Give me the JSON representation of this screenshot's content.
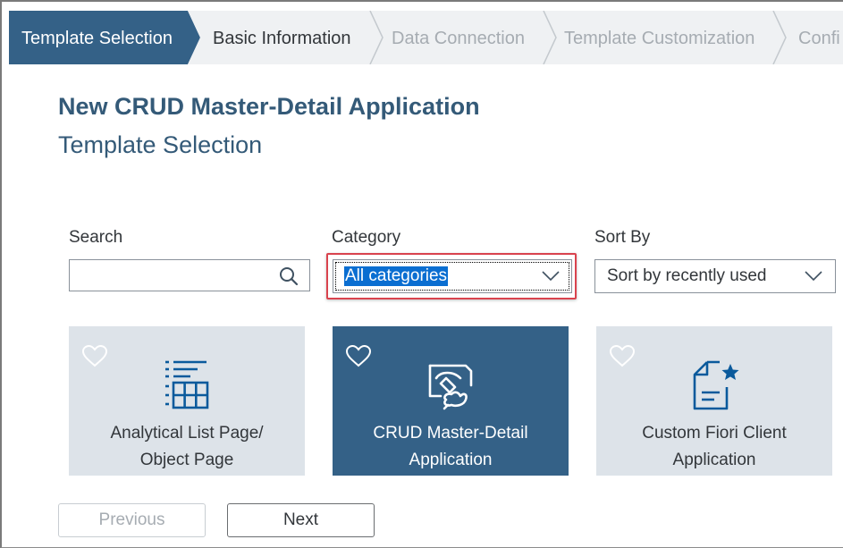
{
  "wizard": {
    "steps": [
      {
        "label": "Template Selection",
        "state": "active"
      },
      {
        "label": "Basic Information",
        "state": "normal"
      },
      {
        "label": "Data Connection",
        "state": "disabled"
      },
      {
        "label": "Template Customization",
        "state": "disabled"
      },
      {
        "label": "Confi",
        "state": "disabled"
      }
    ]
  },
  "page": {
    "title": "New CRUD Master-Detail Application",
    "subtitle": "Template Selection"
  },
  "filters": {
    "search_label": "Search",
    "search_value": "",
    "category_label": "Category",
    "category_value": "All categories",
    "sort_label": "Sort By",
    "sort_value": "Sort by recently used"
  },
  "tiles": [
    {
      "label": "Analytical List Page/\nObject Page",
      "icon": "analytical-list-icon",
      "selected": false
    },
    {
      "label": "CRUD Master-Detail\nApplication",
      "icon": "crud-master-detail-icon",
      "selected": true
    },
    {
      "label": "Custom Fiori Client\nApplication",
      "icon": "custom-fiori-client-icon",
      "selected": false
    }
  ],
  "buttons": {
    "previous": "Previous",
    "next": "Next"
  },
  "colors": {
    "active_step": "#346187",
    "highlight": "#d9434e",
    "selection": "#0a6ed1",
    "tile": "#dde3e9"
  }
}
